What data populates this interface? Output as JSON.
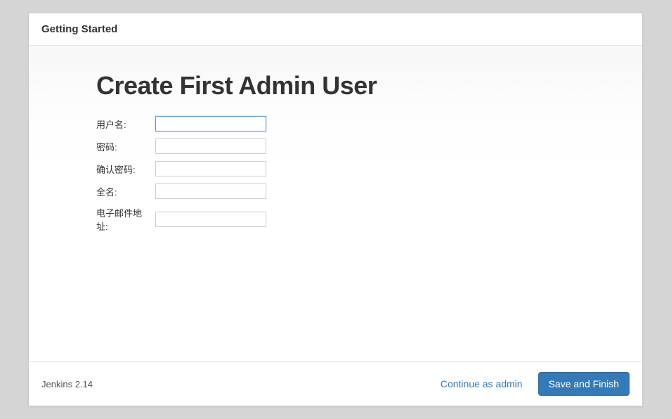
{
  "header": {
    "title": "Getting Started"
  },
  "main": {
    "page_title": "Create First Admin User",
    "form": {
      "username": {
        "label": "用户名:",
        "value": ""
      },
      "password": {
        "label": "密码:",
        "value": ""
      },
      "confirm_password": {
        "label": "确认密码:",
        "value": ""
      },
      "fullname": {
        "label": "全名:",
        "value": ""
      },
      "email": {
        "label": "电子邮件地址:",
        "value": ""
      }
    }
  },
  "footer": {
    "version": "Jenkins 2.14",
    "continue_label": "Continue as admin",
    "save_label": "Save and Finish"
  }
}
